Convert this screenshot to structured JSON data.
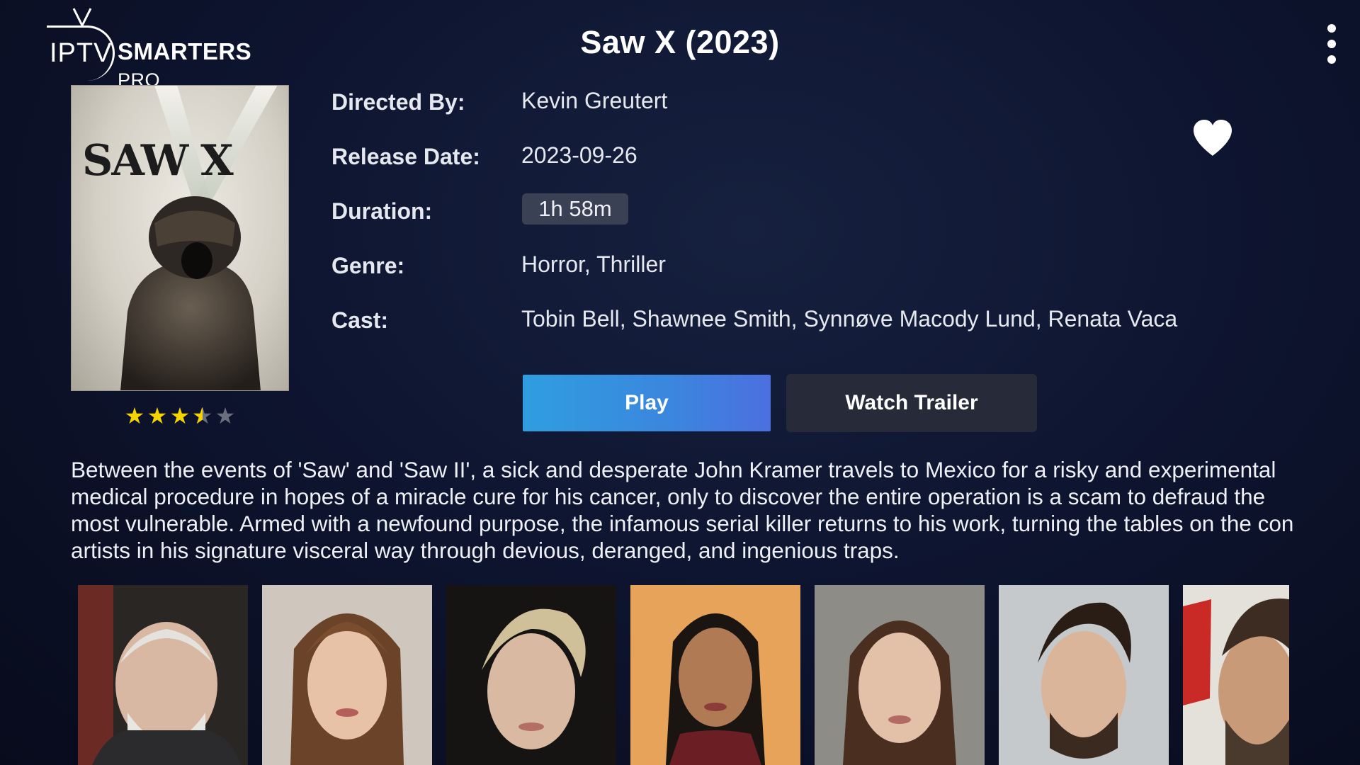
{
  "header": {
    "logo": {
      "iptv": "IPTV",
      "smarters": "SMARTERS",
      "pro": "PRO"
    },
    "title": "Saw X (2023)",
    "menu_icon": "more-vertical-icon"
  },
  "poster": {
    "title_text": "SAW X",
    "rating": {
      "stars_filled": 3.5,
      "stars_total": 5
    }
  },
  "details": {
    "directed_by_label": "Directed By:",
    "directed_by": "Kevin Greutert",
    "release_date_label": "Release Date:",
    "release_date": "2023-09-26",
    "duration_label": "Duration:",
    "duration": "1h 58m",
    "genre_label": "Genre:",
    "genre": "Horror, Thriller",
    "cast_label": "Cast:",
    "cast": "Tobin Bell, Shawnee Smith, Synnøve Macody Lund, Renata Vaca",
    "favorite_icon": "heart-icon"
  },
  "actions": {
    "play_label": "Play",
    "trailer_label": "Watch Trailer"
  },
  "description": "Between the events of 'Saw' and 'Saw II', a sick and desperate John Kramer travels to Mexico for a risky and experimental medical procedure in hopes of a miracle cure for his cancer, only to discover the entire operation is a scam to defraud the most vulnerable. Armed with a newfound purpose, the infamous serial killer returns to his work, turning the tables on the con artists in his signature visceral way through devious, deranged, and ingenious traps.",
  "colors": {
    "background": "#0e1530",
    "play_button": "#3b86de",
    "trailer_button": "#272a38",
    "star": "#f6d400"
  }
}
